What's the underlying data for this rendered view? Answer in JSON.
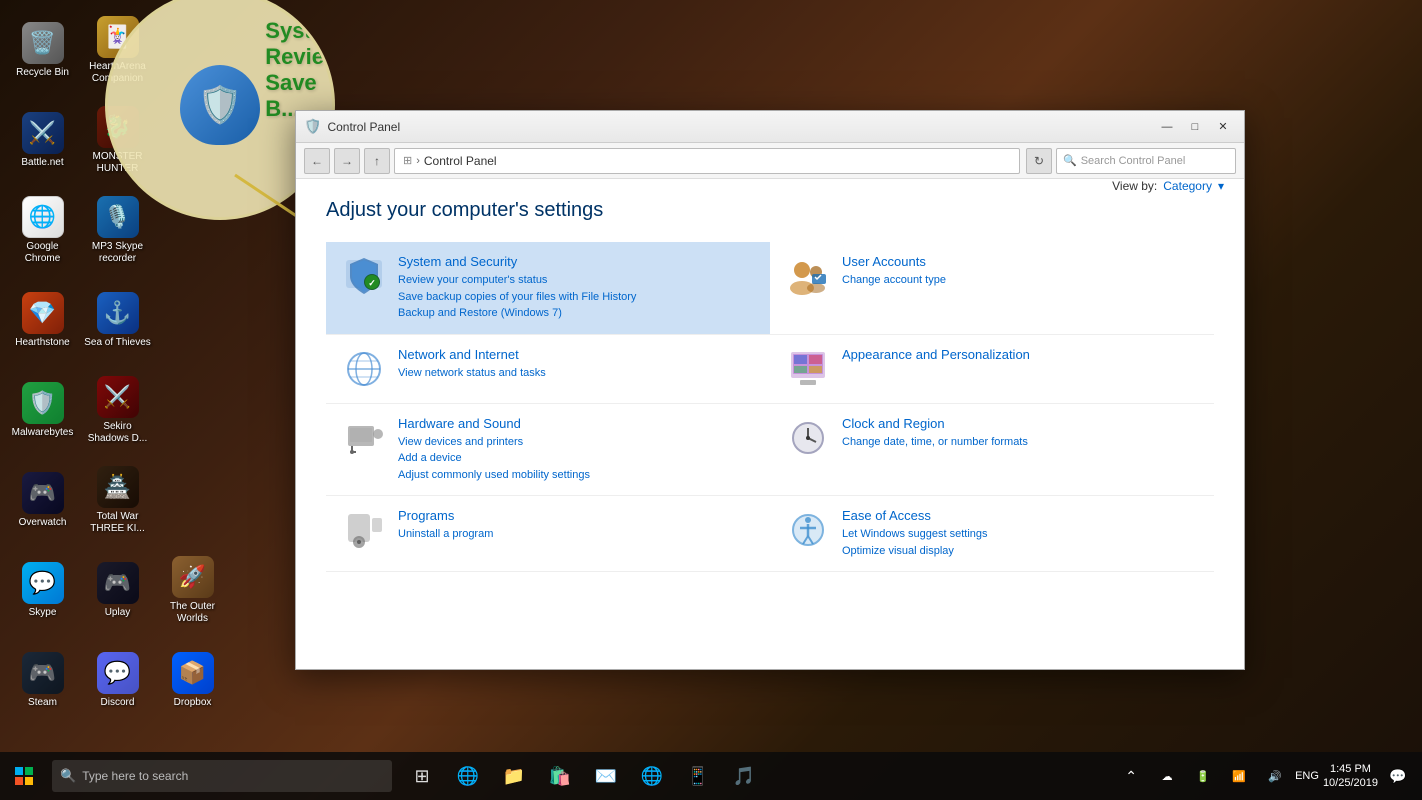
{
  "desktop": {
    "icons": [
      {
        "id": "recycle-bin",
        "label": "Recycle Bin",
        "emoji": "🗑️",
        "col": 1
      },
      {
        "id": "hearthstone-companion",
        "label": "HearthArena Companion",
        "emoji": "🃏",
        "col": 2
      },
      {
        "id": "battle-net",
        "label": "Battle.net",
        "emoji": "⚔️",
        "col": 1
      },
      {
        "id": "monster-hunter",
        "label": "MONSTER HUNTER",
        "emoji": "🐉",
        "col": 2
      },
      {
        "id": "google-chrome",
        "label": "Google Chrome",
        "emoji": "🌐",
        "col": 1
      },
      {
        "id": "mp3-skype",
        "label": "MP3 Skype recorder",
        "emoji": "🎙️",
        "col": 2
      },
      {
        "id": "hearthstone",
        "label": "Hearthstone",
        "emoji": "💎",
        "col": 1
      },
      {
        "id": "sea-of-thieves",
        "label": "Sea of Thieves",
        "emoji": "⚓",
        "col": 2
      },
      {
        "id": "malwarebytes",
        "label": "Malwarebytes",
        "emoji": "🛡️",
        "col": 1
      },
      {
        "id": "sekiro",
        "label": "Sekiro Shadows D...",
        "emoji": "⚔️",
        "col": 2
      },
      {
        "id": "overwatch",
        "label": "Overwatch",
        "emoji": "🎮",
        "col": 1
      },
      {
        "id": "total-war",
        "label": "Total War THREE KI...",
        "emoji": "🏯",
        "col": 2
      },
      {
        "id": "skype",
        "label": "Skype",
        "emoji": "💬",
        "col": 1
      },
      {
        "id": "uplay",
        "label": "Uplay",
        "emoji": "🎮",
        "col": 2
      },
      {
        "id": "outer-worlds",
        "label": "The Outer Worlds",
        "emoji": "🚀",
        "col": 3
      },
      {
        "id": "steam",
        "label": "Steam",
        "emoji": "🎮",
        "col": 1
      },
      {
        "id": "discord",
        "label": "Discord",
        "emoji": "💬",
        "col": 2
      },
      {
        "id": "dropbox",
        "label": "Dropbox",
        "emoji": "📦",
        "col": 3
      }
    ]
  },
  "zoom_circle": {
    "visible": true,
    "text_lines": [
      "Syst",
      "Revie",
      "Save",
      "B..."
    ]
  },
  "control_panel": {
    "title": "Control Panel",
    "page_heading": "Adjust your computer's settings",
    "viewby_label": "View by:",
    "viewby_value": "Category",
    "search_placeholder": "Search Control Panel",
    "address_breadcrumb": "Control Panel",
    "sections": [
      {
        "id": "system-security",
        "title": "System and Security",
        "highlighted": true,
        "links": [
          "Review your computer's status",
          "Save backup copies of your files with File History",
          "Backup and Restore (Windows 7)"
        ],
        "icon": "🛡️",
        "icon_color": "#2a6eb5"
      },
      {
        "id": "user-accounts",
        "title": "User Accounts",
        "highlighted": false,
        "links": [
          "Change account type"
        ],
        "icon": "👥",
        "icon_color": "#c88020"
      },
      {
        "id": "network-internet",
        "title": "Network and Internet",
        "highlighted": false,
        "links": [
          "View network status and tasks"
        ],
        "icon": "🌐",
        "icon_color": "#4a8fd4"
      },
      {
        "id": "appearance-personalization",
        "title": "Appearance and Personalization",
        "highlighted": false,
        "links": [],
        "icon": "🖼️",
        "icon_color": "#9040b0"
      },
      {
        "id": "hardware-sound",
        "title": "Hardware and Sound",
        "highlighted": false,
        "links": [
          "View devices and printers",
          "Add a device",
          "Adjust commonly used mobility settings"
        ],
        "icon": "🖨️",
        "icon_color": "#666"
      },
      {
        "id": "clock-region",
        "title": "Clock and Region",
        "highlighted": false,
        "links": [
          "Change date, time, or number formats"
        ],
        "icon": "🕐",
        "icon_color": "#8888aa"
      },
      {
        "id": "programs",
        "title": "Programs",
        "highlighted": false,
        "links": [
          "Uninstall a program"
        ],
        "icon": "💿",
        "icon_color": "#666"
      },
      {
        "id": "ease-of-access",
        "title": "Ease of Access",
        "highlighted": false,
        "links": [
          "Let Windows suggest settings",
          "Optimize visual display"
        ],
        "icon": "♿",
        "icon_color": "#4090d0"
      }
    ]
  },
  "taskbar": {
    "search_placeholder": "Type here to search",
    "clock_time": "1:45 PM",
    "clock_date": "10/25/2019",
    "language": "ENG"
  }
}
